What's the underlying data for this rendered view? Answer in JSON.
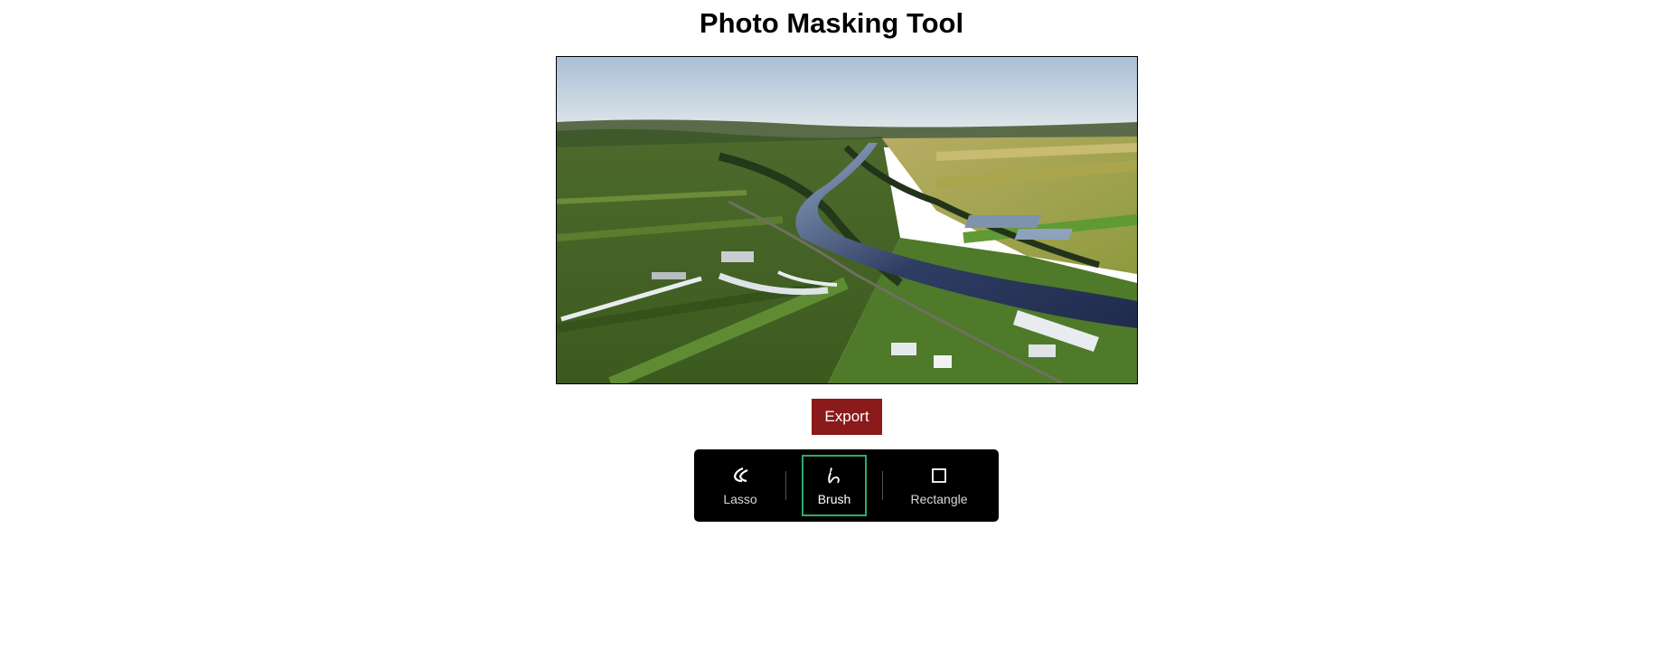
{
  "page": {
    "title": "Photo Masking Tool"
  },
  "image": {
    "description_icon": "landscape-photo"
  },
  "actions": {
    "export_label": "Export"
  },
  "toolbar": {
    "tools": [
      {
        "label": "Lasso",
        "icon": "lasso-icon",
        "selected": false
      },
      {
        "label": "Brush",
        "icon": "brush-icon",
        "selected": true
      },
      {
        "label": "Rectangle",
        "icon": "rectangle-icon",
        "selected": false
      }
    ]
  },
  "colors": {
    "export_bg": "#8b1a1a",
    "toolbar_bg": "#000000",
    "selected_outline": "#2eaa6e"
  }
}
